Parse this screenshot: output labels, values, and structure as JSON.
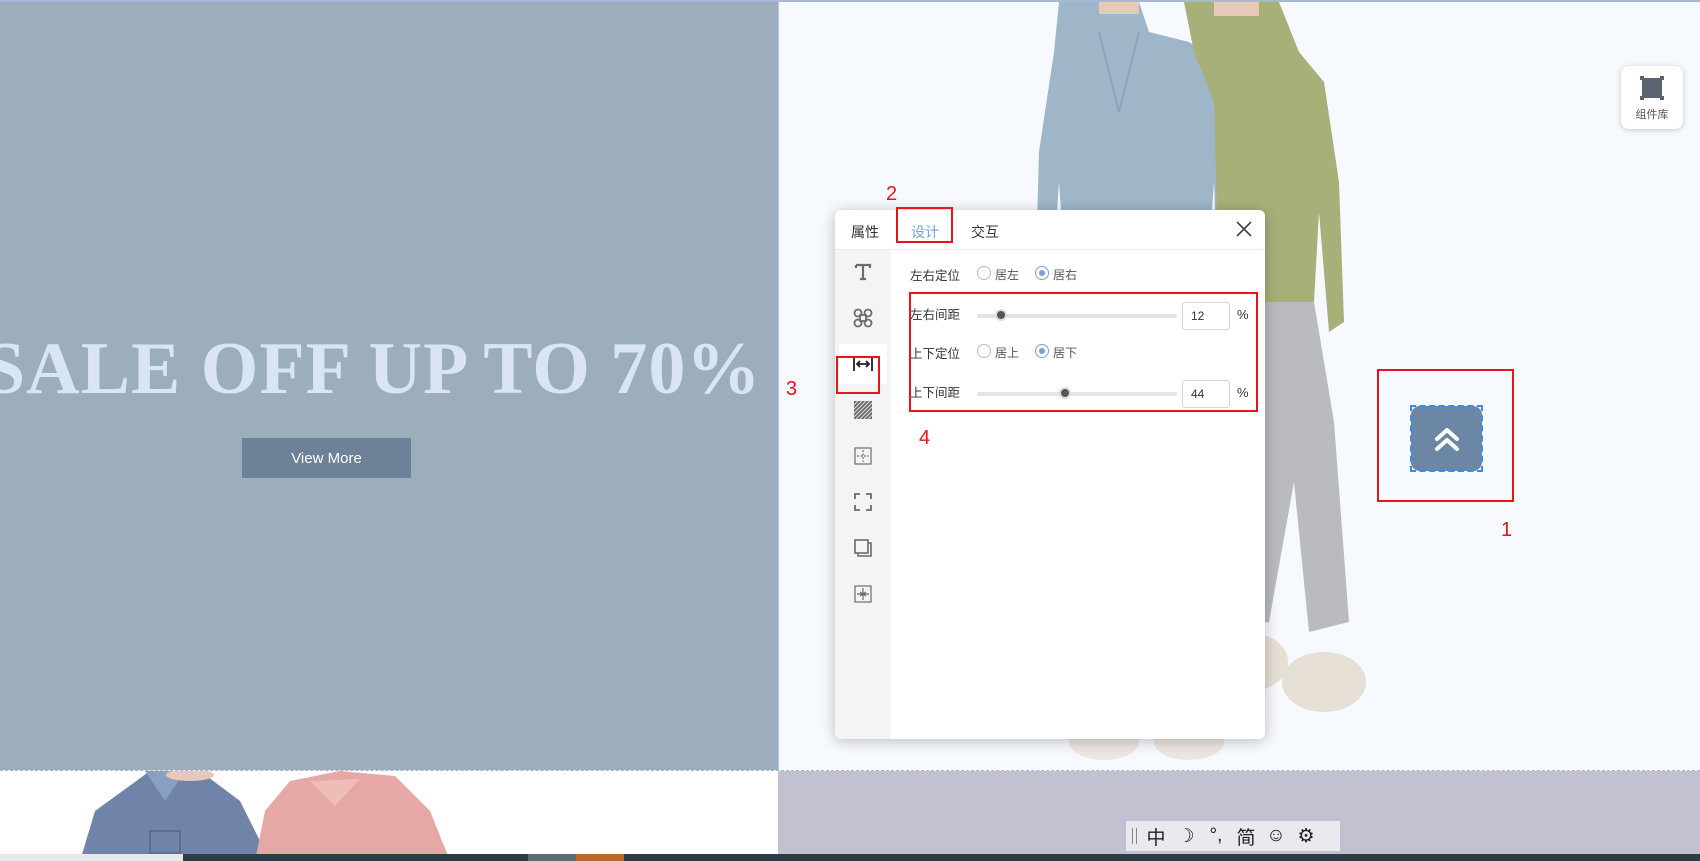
{
  "banner": {
    "headline": "SALE OFF UP TO 70%",
    "cta_label": "View More"
  },
  "component_library": {
    "label": "组件库"
  },
  "dialog": {
    "tabs": [
      {
        "label": "属性",
        "active": false
      },
      {
        "label": "设计",
        "active": true
      },
      {
        "label": "交互",
        "active": false
      }
    ],
    "sidebar_icons": [
      "text-icon",
      "command-icon",
      "horizontal-spacing-icon",
      "hatch-fill-icon",
      "crosshair-grid-icon",
      "corner-frame-icon",
      "layer-shadow-icon",
      "alignment-grid-icon"
    ],
    "horizontal_position": {
      "label": "左右定位",
      "options": [
        "居左",
        "居右"
      ],
      "selected": "居右"
    },
    "horizontal_spacing": {
      "label": "左右间距",
      "value": "12",
      "unit": "%",
      "slider_fraction": 0.12
    },
    "vertical_position": {
      "label": "上下定位",
      "options": [
        "居上",
        "居下"
      ],
      "selected": "居下"
    },
    "vertical_spacing": {
      "label": "上下间距",
      "value": "44",
      "unit": "%",
      "slider_fraction": 0.44
    }
  },
  "annotations": [
    "1",
    "2",
    "3",
    "4"
  ],
  "ime_toolbar": {
    "items": [
      "中",
      "☽",
      "°,",
      "简",
      "☺",
      "⚙"
    ]
  },
  "colors": {
    "banner_left_bg": "#9cadbc",
    "headline": "#d9e6f1",
    "cta_bg": "#6d8199",
    "back_to_top_bg": "#6c87a6",
    "annotation_red": "#e8141a",
    "active_tab": "#6fa3e0"
  }
}
